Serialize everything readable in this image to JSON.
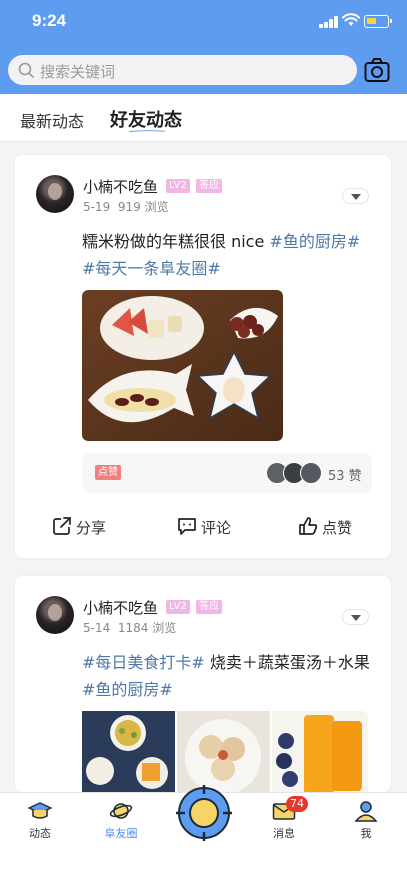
{
  "status_bar": {
    "time": "9:24"
  },
  "search": {
    "placeholder": "搜索关键词"
  },
  "tabs": [
    {
      "label": "最新动态",
      "active": false
    },
    {
      "label": "好友动态",
      "active": true
    }
  ],
  "posts": [
    {
      "username": "小楠不吃鱼",
      "level": "LV2",
      "badge": "答应",
      "date": "5-19",
      "views": "919 浏览",
      "text_plain": "糯米粉做的年糕很很 nice ",
      "tag1": "#鱼的厨房#",
      "tag2": "#每天一条阜友圈#",
      "like_label": "点赞",
      "like_count": "53 赞"
    },
    {
      "username": "小楠不吃鱼",
      "level": "LV2",
      "badge": "答应",
      "date": "5-14",
      "views": "1184 浏览",
      "tag1": "#每日美食打卡#",
      "text_plain": " 烧卖＋蔬菜蛋汤＋水果",
      "tag2": "#鱼的厨房#"
    }
  ],
  "actions": {
    "share": "分享",
    "comment": "评论",
    "like": "点赞"
  },
  "tabbar": [
    {
      "label": "动态",
      "icon": "grad-cap-icon",
      "active": false
    },
    {
      "label": "阜友圈",
      "icon": "planet-icon",
      "active": true
    },
    {
      "label": "",
      "icon": "camera-target-icon",
      "active": false
    },
    {
      "label": "消息",
      "icon": "mail-icon",
      "active": false
    },
    {
      "label": "我",
      "icon": "person-icon",
      "active": false
    }
  ],
  "notification_count": "74",
  "colors": {
    "primary": "#5e9cf0",
    "tag": "#4f78a6",
    "badge_pink": "#f1b6e6",
    "notif_red": "#e7362e"
  }
}
